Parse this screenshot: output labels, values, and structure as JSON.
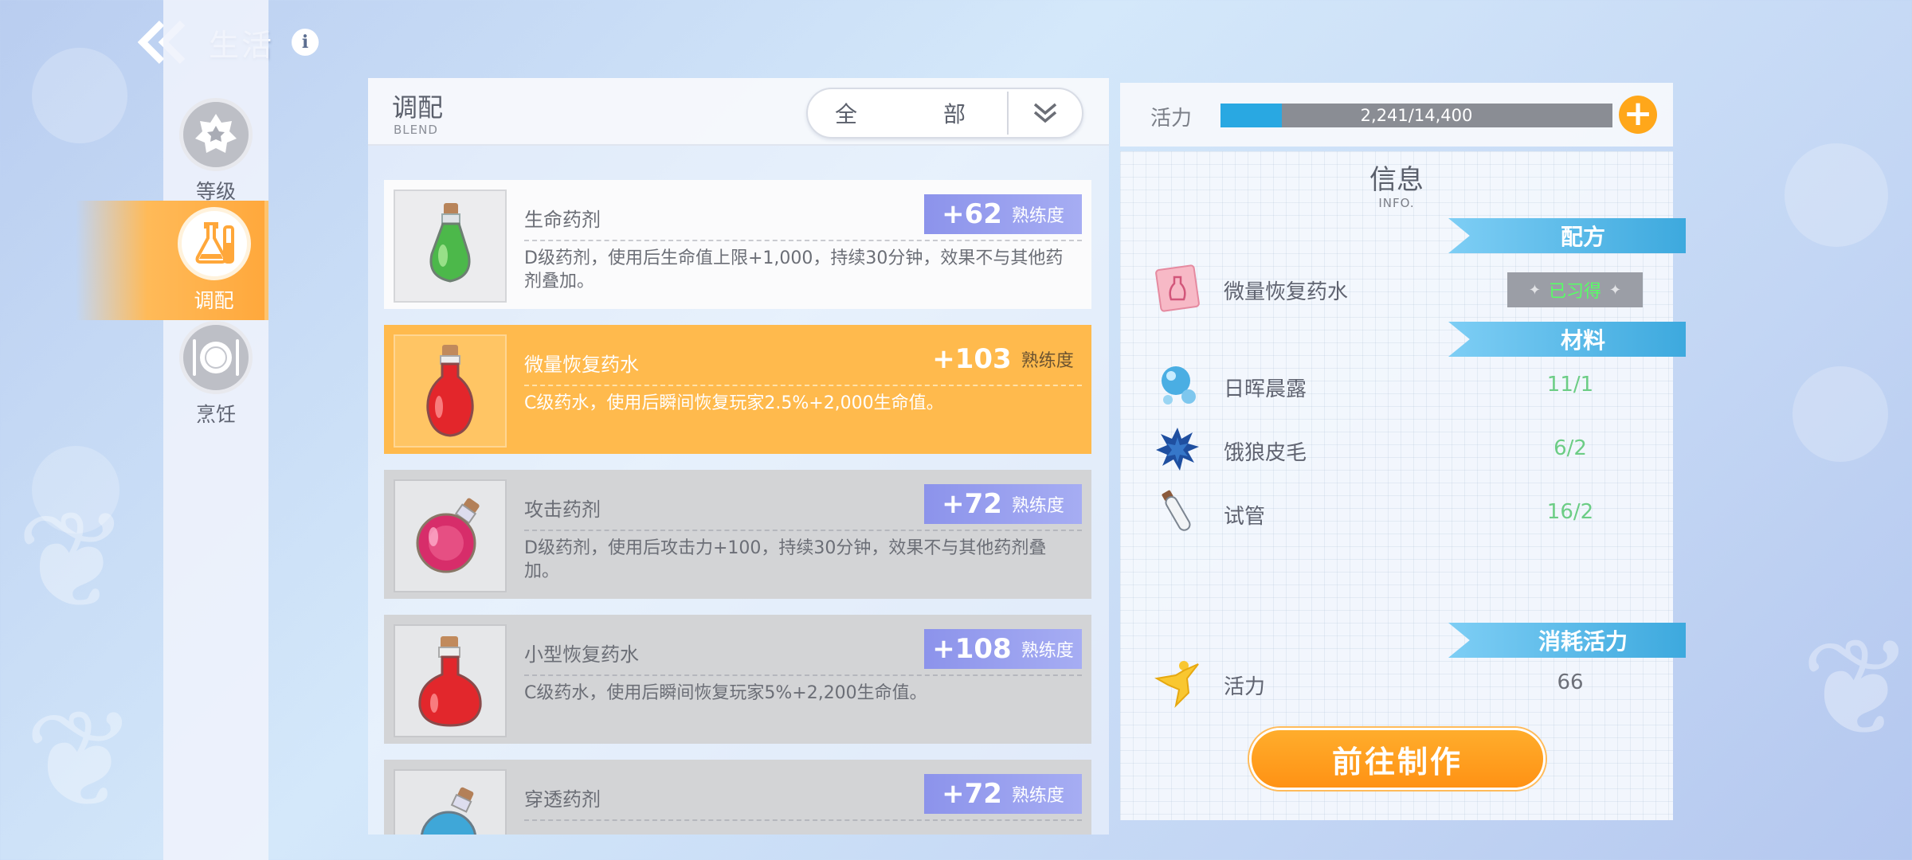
{
  "header": {
    "title": "生活",
    "back_icon": "double-chevron-left-icon",
    "info_icon": "info-icon",
    "info_glyph": "i"
  },
  "nav": {
    "items": [
      {
        "label": "等级",
        "icon": "gear-badge-icon",
        "active": false
      },
      {
        "label": "调配",
        "icon": "flask-icon",
        "active": true
      },
      {
        "label": "烹饪",
        "icon": "plate-icon",
        "active": false
      }
    ]
  },
  "list": {
    "title": "调配",
    "subtitle": "BLEND",
    "filter_label": "全部",
    "filter_icon": "chevron-double-down-icon",
    "xp_unit": "熟练度",
    "items": [
      {
        "name": "生命药剂",
        "xp": "+62",
        "desc": "D级药剂，使用后生命值上限+1,000，持续30分钟，效果不与其他药剂叠加。",
        "icon": "green-potion-icon",
        "state": "white"
      },
      {
        "name": "微量恢复药水",
        "xp": "+103",
        "desc": "C级药水，使用后瞬间恢复玩家2.5%+2,000生命值。",
        "icon": "red-potion-icon",
        "state": "active"
      },
      {
        "name": "攻击药剂",
        "xp": "+72",
        "desc": "D级药剂，使用后攻击力+100，持续30分钟，效果不与其他药剂叠加。",
        "icon": "pink-potion-icon",
        "state": "grey"
      },
      {
        "name": "小型恢复药水",
        "xp": "+108",
        "desc": "C级药水，使用后瞬间恢复玩家5%+2,200生命值。",
        "icon": "red-flask-icon",
        "state": "grey"
      },
      {
        "name": "穿透药剂",
        "xp": "+72",
        "desc": "",
        "icon": "blue-potion-icon",
        "state": "grey"
      }
    ]
  },
  "stamina": {
    "label": "活力",
    "text": "2,241/14,400",
    "fraction": 0.156,
    "add_icon": "plus-icon",
    "add_glyph": "+"
  },
  "info": {
    "title": "信息",
    "subtitle": "INFO.",
    "recipe_tag": "配方",
    "recipe": {
      "name": "微量恢复药水",
      "status": "已习得",
      "icon": "recipe-scroll-icon"
    },
    "materials_tag": "材料",
    "materials": [
      {
        "name": "日晖晨露",
        "count": "11/1",
        "icon": "dew-drop-icon"
      },
      {
        "name": "饿狼皮毛",
        "count": "6/2",
        "icon": "fur-icon"
      },
      {
        "name": "试管",
        "count": "16/2",
        "icon": "test-tube-icon"
      }
    ],
    "cost_tag": "消耗活力",
    "cost": {
      "name": "活力",
      "value": "66",
      "icon": "stamina-figure-icon"
    },
    "make_button": "前往制作"
  },
  "colors": {
    "accent_orange": "#ffa71a",
    "active_row": "#ffba4d",
    "xp_badge": "#8c93eb",
    "stamina_fill": "#29a8e2",
    "tag_blue": "#3da9de",
    "material_green": "#6ccd85"
  }
}
